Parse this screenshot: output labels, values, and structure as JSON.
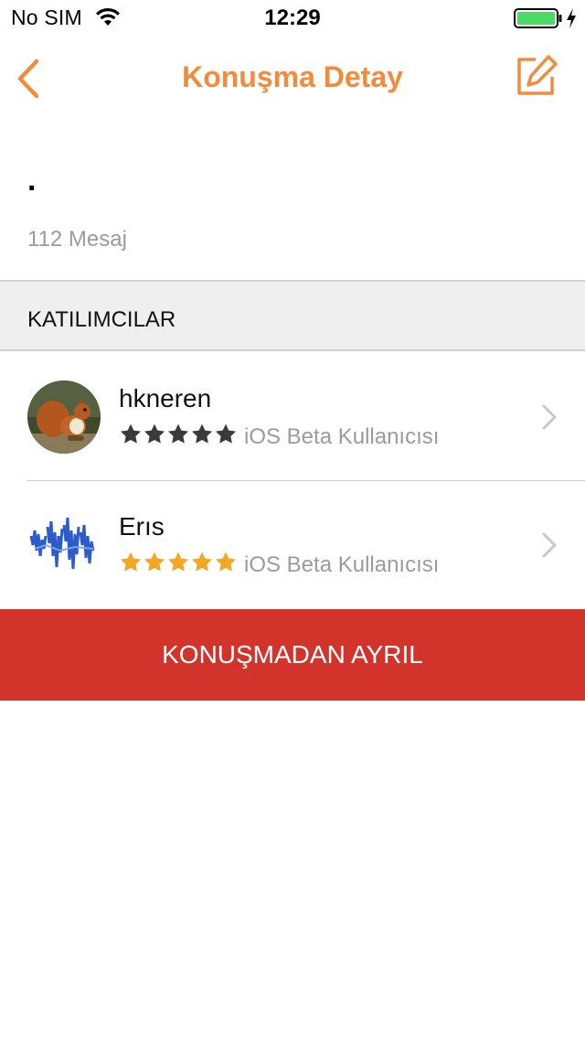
{
  "status_bar": {
    "carrier": "No SIM",
    "time": "12:29",
    "battery_color": "#4cd964"
  },
  "nav": {
    "title": "Konuşma Detay",
    "back_icon": "chevron-left-icon",
    "compose_icon": "compose-icon",
    "accent_color": "#f28c3c"
  },
  "conversation": {
    "name": ".",
    "message_count": "112 Mesaj"
  },
  "participants_section": {
    "title": "KATILIMCILAR"
  },
  "participants": [
    {
      "name": "hkneren",
      "rating": 5,
      "star_color": "#3a3a3a",
      "badge": "iOS Beta Kullanıcısı",
      "avatar": "squirrel-photo"
    },
    {
      "name": "Erıs",
      "rating": 5,
      "star_color": "#f5a623",
      "badge": "iOS Beta Kullanıcısı",
      "avatar": "blue-waveform-logo"
    }
  ],
  "leave_button": {
    "label": "KONUŞMADAN AYRIL",
    "color": "#d2342c"
  }
}
